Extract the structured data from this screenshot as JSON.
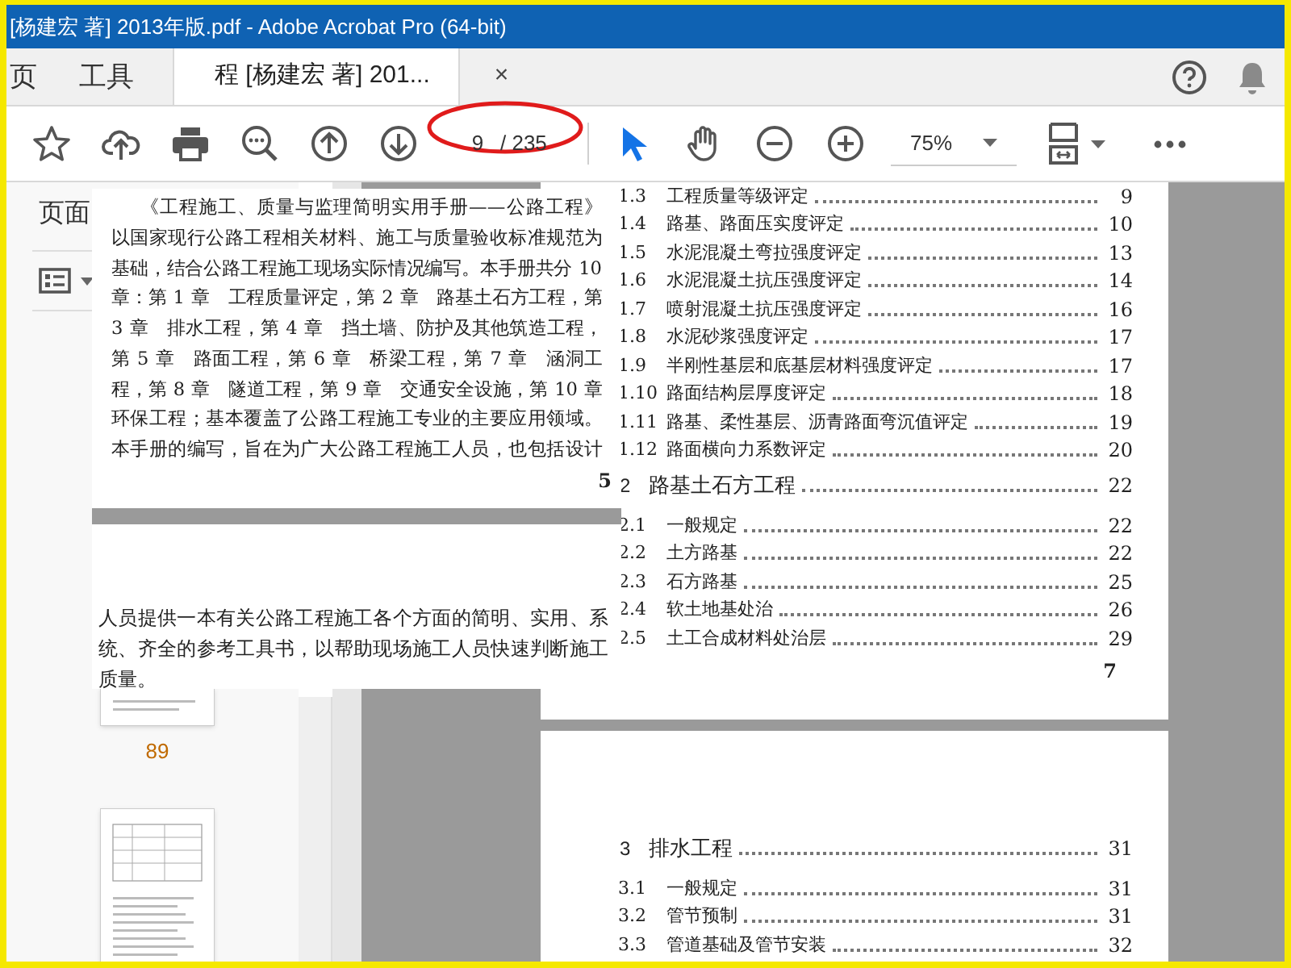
{
  "window": {
    "title": "[杨建宏 著] 2013年版.pdf - Adobe Acrobat Pro (64-bit)"
  },
  "tabs": [
    {
      "label": "页",
      "selected": false
    },
    {
      "label": "工具",
      "selected": false
    },
    {
      "label": "程 [杨建宏 著] 201...",
      "selected": true,
      "close": "×"
    }
  ],
  "toolbar": {
    "page_number": "9",
    "page_count": "/ 235",
    "zoom": "75%",
    "tools": [
      {
        "kind": "select",
        "selected": true
      },
      {
        "kind": "hand",
        "selected": false
      }
    ]
  },
  "sidebar": {
    "title": "页面",
    "thumbnail_labels": [
      "89"
    ]
  },
  "overlay_page": {
    "paragraph_1": [
      "《工程施工、质量与监理简明实用手册——公路工程》",
      "以国家现行公路工程相关材料、施工与质量验收标准规范为",
      "基础，结合公路工程施工现场实际情况编写。本手册共分 10",
      "章：第 1 章　工程质量评定，第 2 章　路基土石方工程，第",
      "3 章　排水工程，第 4 章　挡土墙、防护及其他筑造工程，",
      "第 5 章　路面工程，第 6 章　桥梁工程，第 7 章　涵洞工",
      "程，第 8 章　隧道工程，第 9 章　交通安全设施，第 10 章",
      "环保工程；基本覆盖了公路工程施工专业的主要应用领域。",
      "本手册的编写，旨在为广大公路工程施工人员，也包括设计"
    ],
    "page_number": "5",
    "paragraph_2": [
      "人员提供一本有关公路工程施工各个方面的简明、实用、系",
      "统、齐全的参考工具书，以帮助现场施工人员快速判断施工",
      "质量。"
    ]
  },
  "toc_pages": [
    {
      "entries": [
        {
          "kind": "section",
          "number": "1.3",
          "title": "工程质量等级评定",
          "page": "9"
        },
        {
          "kind": "section",
          "number": "1.4",
          "title": "路基、路面压实度评定",
          "page": "10"
        },
        {
          "kind": "section",
          "number": "1.5",
          "title": "水泥混凝土弯拉强度评定",
          "page": "13"
        },
        {
          "kind": "section",
          "number": "1.6",
          "title": "水泥混凝土抗压强度评定",
          "page": "14"
        },
        {
          "kind": "section",
          "number": "1.7",
          "title": "喷射混凝土抗压强度评定",
          "page": "16"
        },
        {
          "kind": "section",
          "number": "1.8",
          "title": "水泥砂浆强度评定",
          "page": "17"
        },
        {
          "kind": "section",
          "number": "1.9",
          "title": "半刚性基层和底基层材料强度评定",
          "page": "17"
        },
        {
          "kind": "section",
          "number": "1.10",
          "title": "路面结构层厚度评定",
          "page": "18"
        },
        {
          "kind": "section",
          "number": "1.11",
          "title": "路基、柔性基层、沥青路面弯沉值评定",
          "page": "19"
        },
        {
          "kind": "section",
          "number": "1.12",
          "title": "路面横向力系数评定",
          "page": "20"
        },
        {
          "kind": "chapter",
          "number": "2",
          "title": "路基土石方工程",
          "page": "22"
        },
        {
          "kind": "section",
          "number": "2.1",
          "title": "一般规定",
          "page": "22"
        },
        {
          "kind": "section",
          "number": "2.2",
          "title": "土方路基",
          "page": "22"
        },
        {
          "kind": "section",
          "number": "2.3",
          "title": "石方路基",
          "page": "25"
        },
        {
          "kind": "section",
          "number": "2.4",
          "title": "软土地基处治",
          "page": "26"
        },
        {
          "kind": "section",
          "number": "2.5",
          "title": "土工合成材料处治层",
          "page": "29"
        }
      ],
      "page_number": "7"
    },
    {
      "entries": [
        {
          "kind": "chapter",
          "number": "3",
          "title": "排水工程",
          "page": "31"
        },
        {
          "kind": "section",
          "number": "3.1",
          "title": "一般规定",
          "page": "31"
        },
        {
          "kind": "section",
          "number": "3.2",
          "title": "管节预制",
          "page": "31"
        },
        {
          "kind": "section",
          "number": "3.3",
          "title": "管道基础及管节安装",
          "page": "32"
        }
      ]
    }
  ]
}
